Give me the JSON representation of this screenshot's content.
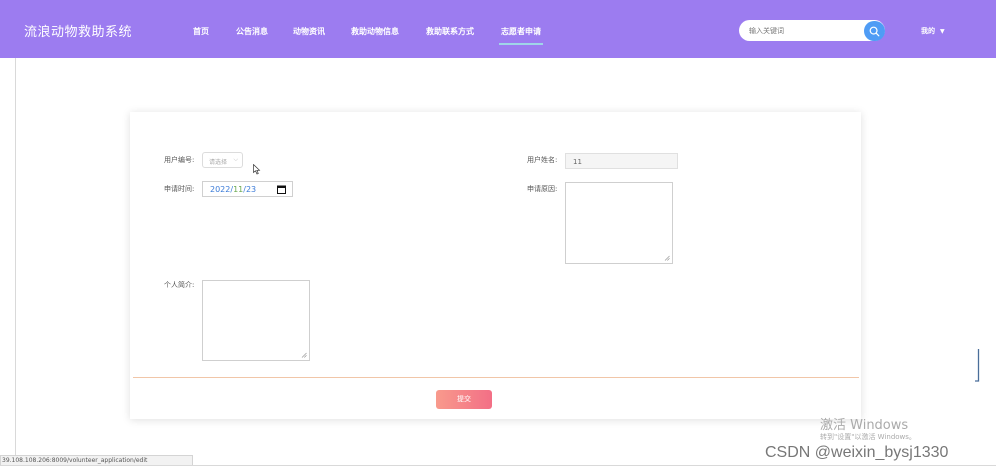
{
  "app": {
    "title": "流浪动物救助系统"
  },
  "nav": {
    "items": [
      {
        "label": "首页"
      },
      {
        "label": "公告消息"
      },
      {
        "label": "动物资讯"
      },
      {
        "label": "救助动物信息"
      },
      {
        "label": "救助联系方式"
      },
      {
        "label": "志愿者申请",
        "active": true
      }
    ]
  },
  "search": {
    "placeholder": "输入关键词",
    "value": ""
  },
  "user_menu": {
    "label": "我的",
    "chevron": "▼"
  },
  "form": {
    "user_no_label": "用户编号:",
    "user_no_select": "请选择",
    "user_name_label": "用户姓名:",
    "user_name_value": "11",
    "apply_time_label": "申请时间:",
    "apply_date": {
      "year": "2022",
      "month": "11",
      "day": "23",
      "sep": "/"
    },
    "reason_label": "申请原因:",
    "intro_label": "个人简介:",
    "submit_label": "提交"
  },
  "statusbar": {
    "url": "39.108.108.206:8009/volunteer_application/edit"
  },
  "watermark": {
    "title": "激活 Windows",
    "subtitle": "转到\"设置\"以激活 Windows。",
    "csdn": "CSDN @weixin_bysj1330"
  },
  "colors": {
    "header_bg": "#9c7cf0",
    "search_button": "#4f9cf5",
    "submit_gradient_start": "#f89a8c",
    "submit_gradient_end": "#f36f86",
    "divider": "#f1c6a8",
    "active_tab_underline": "#9fd5e8"
  },
  "icons": {
    "search": "search-icon",
    "calendar": "calendar-icon",
    "dropdown": "chevron-down-icon",
    "cursor": "mouse-cursor-icon"
  }
}
